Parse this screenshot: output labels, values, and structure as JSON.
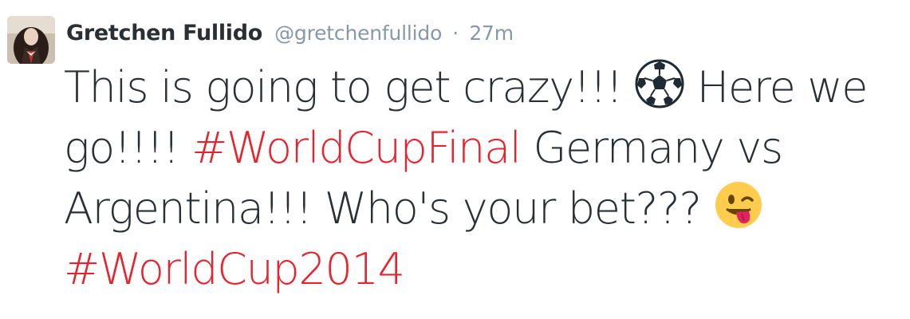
{
  "tweet": {
    "display_name": "Gretchen Fullido",
    "handle": "@gretchenfullido",
    "separator": "·",
    "time": "27m",
    "text": {
      "part1": "This is going to get crazy!!! ",
      "part2": " Here we go!!!! ",
      "hashtag1": "#WorldCupFinal",
      "part3": " Germany vs Argentina!!! Who's your bet??? ",
      "hashtag2": "#WorldCup2014"
    },
    "hashtag_color": "#e8232d",
    "emoji1": "soccer-ball-icon",
    "emoji2": "winking-face-tongue-icon"
  }
}
